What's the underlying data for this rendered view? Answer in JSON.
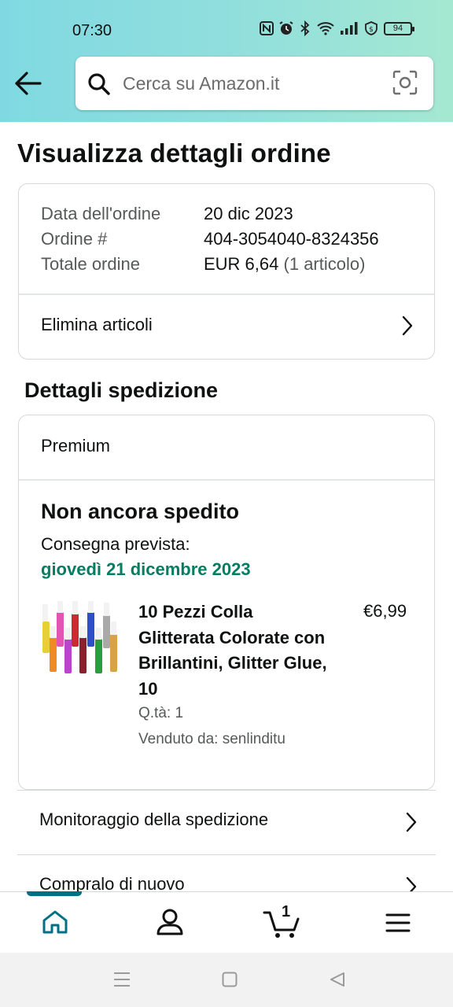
{
  "status_bar": {
    "time": "07:30",
    "battery": "94"
  },
  "search": {
    "placeholder": "Cerca su Amazon.it"
  },
  "page_title": "Visualizza dettagli ordine",
  "order_summary": {
    "date_label": "Data dell'ordine",
    "date_value": "20 dic 2023",
    "order_label": "Ordine #",
    "order_value": "404-3054040-8324356",
    "total_label": "Totale ordine",
    "total_value": "EUR 6,64",
    "total_items": "(1 articolo)",
    "delete_items_label": "Elimina articoli"
  },
  "shipping": {
    "heading": "Dettagli spedizione",
    "service": "Premium",
    "status": "Non ancora spedito",
    "delivery_label": "Consegna prevista:",
    "delivery_date": "giovedì 21 dicembre 2023",
    "delivery_date_color": "#067d62",
    "product": {
      "title": "10 Pezzi Colla Glitterata Colorate con Brillantini, Glitter Glue, 10",
      "price": "€6,99",
      "quantity": "Q.tà: 1",
      "seller": "Venduto da: senlinditu"
    }
  },
  "actions": [
    {
      "label": "Monitoraggio della spedizione"
    },
    {
      "label": "Compralo di nuovo"
    }
  ],
  "tabbar": {
    "active_color": "#007185",
    "cart_count": "1",
    "tabs": [
      {
        "icon": "home-icon"
      },
      {
        "icon": "account-icon"
      },
      {
        "icon": "cart-icon"
      },
      {
        "icon": "menu-icon"
      }
    ]
  },
  "accent": {
    "header_start": "#80d9e2",
    "header_end": "#a5e8d2"
  }
}
